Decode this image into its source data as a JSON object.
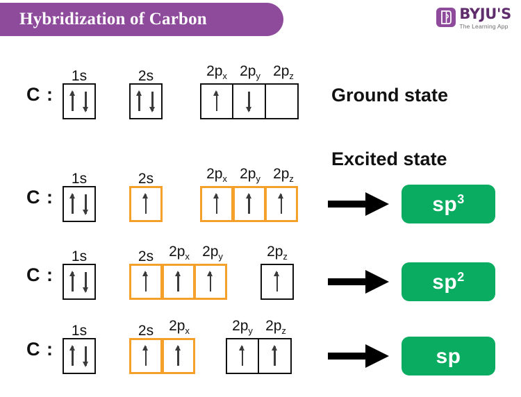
{
  "header": {
    "title": "Hybridization of Carbon",
    "banner_color": "#8e4a9b",
    "logo": {
      "name": "BYJU'S",
      "tagline": "The Learning App",
      "mark_icon": "byjus-book-icon"
    }
  },
  "colors": {
    "orange_box": "#f5a02a",
    "black_box": "#111111",
    "badge_green": "#0aac61",
    "purple": "#8e4a9b"
  },
  "atom_label": "C :",
  "state_labels": {
    "ground": "Ground state",
    "excited": "Excited state"
  },
  "rows": [
    {
      "id": "ground-state",
      "groups": [
        {
          "style": "black",
          "orbitals": [
            {
              "label": "1s",
              "sub": "",
              "spins": [
                "up",
                "down"
              ]
            }
          ]
        },
        {
          "style": "black",
          "orbitals": [
            {
              "label": "2s",
              "sub": "",
              "spins": [
                "up",
                "down"
              ]
            }
          ]
        },
        {
          "style": "black",
          "orbitals": [
            {
              "label": "2p",
              "sub": "x",
              "spins": [
                "up"
              ]
            },
            {
              "label": "2p",
              "sub": "y",
              "spins": [
                "down"
              ]
            },
            {
              "label": "2p",
              "sub": "z",
              "spins": []
            }
          ]
        }
      ]
    },
    {
      "id": "sp3-state",
      "groups": [
        {
          "style": "black",
          "orbitals": [
            {
              "label": "1s",
              "sub": "",
              "spins": [
                "up",
                "down"
              ]
            }
          ]
        },
        {
          "style": "orange",
          "orbitals": [
            {
              "label": "2s",
              "sub": "",
              "spins": [
                "up"
              ]
            }
          ]
        },
        {
          "style": "orange",
          "orbitals": [
            {
              "label": "2p",
              "sub": "x",
              "spins": [
                "up"
              ]
            },
            {
              "label": "2p",
              "sub": "y",
              "spins": [
                "up"
              ]
            },
            {
              "label": "2p",
              "sub": "z",
              "spins": [
                "up"
              ]
            }
          ]
        }
      ],
      "hybrid": {
        "base": "sp",
        "exponent": "3"
      }
    },
    {
      "id": "sp2-state",
      "groups": [
        {
          "style": "black",
          "orbitals": [
            {
              "label": "1s",
              "sub": "",
              "spins": [
                "up",
                "down"
              ]
            }
          ]
        },
        {
          "style": "orange",
          "orbitals": [
            {
              "label": "2s",
              "sub": "",
              "spins": [
                "up"
              ]
            },
            {
              "label": "2p",
              "sub": "x",
              "spins": [
                "up"
              ]
            },
            {
              "label": "2p",
              "sub": "y",
              "spins": [
                "up"
              ]
            }
          ]
        },
        {
          "style": "black",
          "orbitals": [
            {
              "label": "2p",
              "sub": "z",
              "spins": [
                "up"
              ]
            }
          ]
        }
      ],
      "hybrid": {
        "base": "sp",
        "exponent": "2"
      }
    },
    {
      "id": "sp-state",
      "groups": [
        {
          "style": "black",
          "orbitals": [
            {
              "label": "1s",
              "sub": "",
              "spins": [
                "up",
                "down"
              ]
            }
          ]
        },
        {
          "style": "orange",
          "orbitals": [
            {
              "label": "2s",
              "sub": "",
              "spins": [
                "up"
              ]
            },
            {
              "label": "2p",
              "sub": "x",
              "spins": [
                "up"
              ]
            }
          ]
        },
        {
          "style": "black",
          "orbitals": [
            {
              "label": "2p",
              "sub": "y",
              "spins": [
                "up"
              ]
            },
            {
              "label": "2p",
              "sub": "z",
              "spins": [
                "up"
              ]
            }
          ]
        }
      ],
      "hybrid": {
        "base": "sp",
        "exponent": ""
      }
    }
  ]
}
